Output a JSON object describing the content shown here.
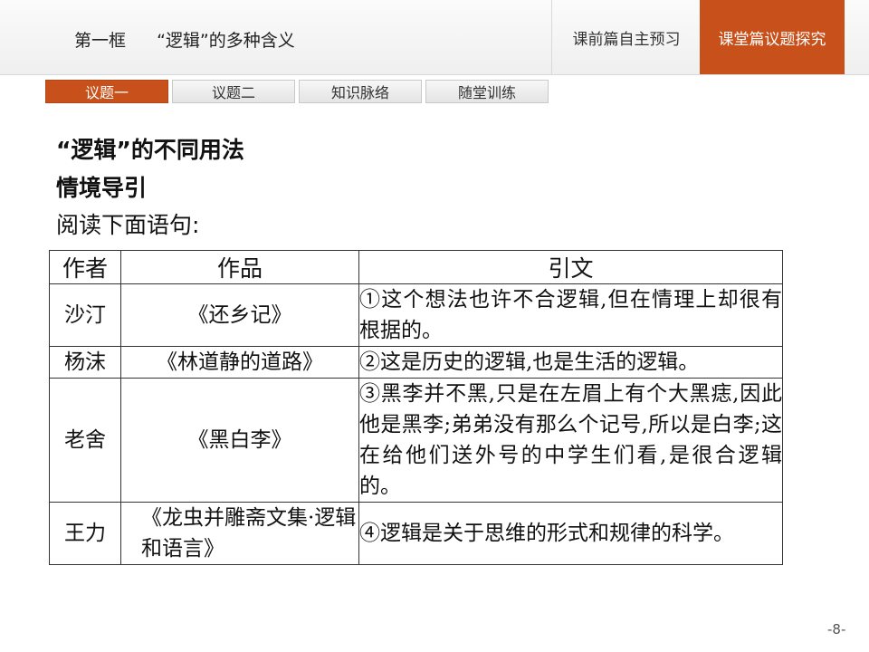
{
  "header": {
    "chapter": "第一框",
    "title": "“逻辑”的多种含义",
    "nav": [
      "课前篇自主预习",
      "课堂篇议题探究"
    ]
  },
  "tabs": [
    "议题一",
    "议题二",
    "知识脉络",
    "随堂训练"
  ],
  "content": {
    "heading": "“逻辑”的不同用法",
    "subheading": "情境导引",
    "intro": "阅读下面语句:"
  },
  "table": {
    "headers": [
      "作者",
      "作品",
      "引文"
    ],
    "rows": [
      {
        "author": "沙汀",
        "work": "《还乡记》",
        "quote": "①这个想法也许不合逻辑,但在情理上却很有根据的。"
      },
      {
        "author": "杨沫",
        "work": "《林道静的道路》",
        "quote": "②这是历史的逻辑,也是生活的逻辑。"
      },
      {
        "author": "老舍",
        "work": "《黑白李》",
        "quote": "③黑李并不黑,只是在左眉上有个大黑痣,因此他是黑李;弟弟没有那么个记号,所以是白李;这在给他们送外号的中学生们看,是很合逻辑的。"
      },
      {
        "author": "王力",
        "work": "《龙虫并雕斋文集·逻辑和语言》",
        "quote": "④逻辑是关于思维的形式和规律的科学。"
      }
    ]
  },
  "page": "-8-",
  "colors": {
    "accent": "#c8501b"
  }
}
